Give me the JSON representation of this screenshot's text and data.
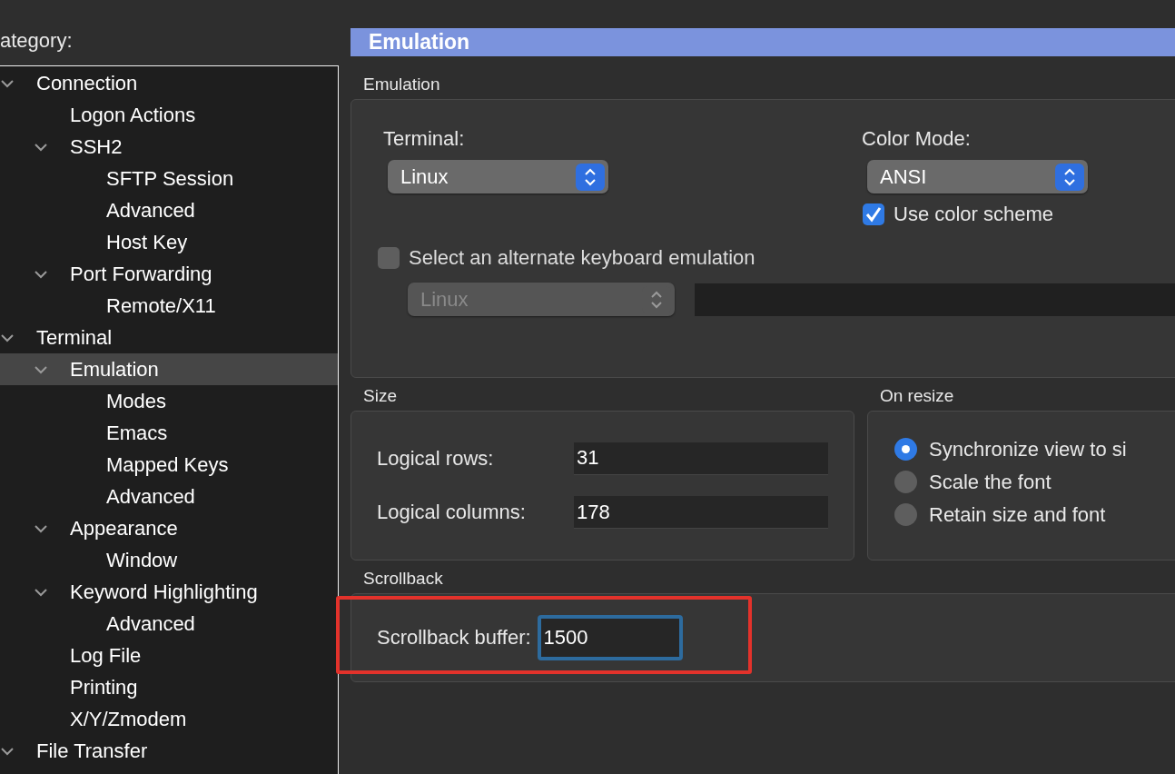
{
  "category_label": "ategory:",
  "tree": [
    {
      "label": "Connection",
      "expanded": true,
      "selected": false,
      "children": [
        {
          "label": "Logon Actions",
          "selected": false
        },
        {
          "label": "SSH2",
          "expanded": true,
          "selected": false,
          "children": [
            {
              "label": "SFTP Session",
              "selected": false
            },
            {
              "label": "Advanced",
              "selected": false
            },
            {
              "label": "Host Key",
              "selected": false
            }
          ]
        },
        {
          "label": "Port Forwarding",
          "expanded": true,
          "selected": false,
          "children": [
            {
              "label": "Remote/X11",
              "selected": false
            }
          ]
        }
      ]
    },
    {
      "label": "Terminal",
      "expanded": true,
      "selected": false,
      "children": [
        {
          "label": "Emulation",
          "expanded": true,
          "selected": true,
          "children": [
            {
              "label": "Modes",
              "selected": false
            },
            {
              "label": "Emacs",
              "selected": false
            },
            {
              "label": "Mapped Keys",
              "selected": false
            },
            {
              "label": "Advanced",
              "selected": false
            }
          ]
        },
        {
          "label": "Appearance",
          "expanded": true,
          "selected": false,
          "children": [
            {
              "label": "Window",
              "selected": false
            }
          ]
        },
        {
          "label": "Keyword Highlighting",
          "expanded": true,
          "selected": false,
          "children": [
            {
              "label": "Advanced",
              "selected": false
            }
          ]
        },
        {
          "label": "Log File",
          "selected": false
        },
        {
          "label": "Printing",
          "selected": false
        },
        {
          "label": "X/Y/Zmodem",
          "selected": false
        }
      ]
    },
    {
      "label": "File Transfer",
      "expanded": true,
      "selected": false
    }
  ],
  "panel_title": "Emulation",
  "emulation_group": {
    "title": "Emulation",
    "terminal": {
      "label": "Terminal:",
      "value": "Linux"
    },
    "color_mode": {
      "label": "Color Mode:",
      "value": "ANSI"
    },
    "use_color_scheme": {
      "label": "Use color scheme",
      "checked": true
    },
    "alternate_keyboard": {
      "label": "Select an alternate keyboard emulation",
      "checked": false,
      "value": "Linux"
    }
  },
  "size_group": {
    "title": "Size",
    "fields": [
      {
        "label": "Logical rows:",
        "value": "31"
      },
      {
        "label": "Logical columns:",
        "value": "178"
      }
    ]
  },
  "on_resize_group": {
    "title": "On resize",
    "options": [
      {
        "label": "Synchronize view to si",
        "selected": true
      },
      {
        "label": "Scale the font",
        "selected": false
      },
      {
        "label": "Retain size and font",
        "selected": false
      }
    ]
  },
  "scrollback_group": {
    "title": "Scrollback",
    "field": {
      "label": "Scrollback buffer:",
      "value": "1500",
      "focused": true
    }
  }
}
